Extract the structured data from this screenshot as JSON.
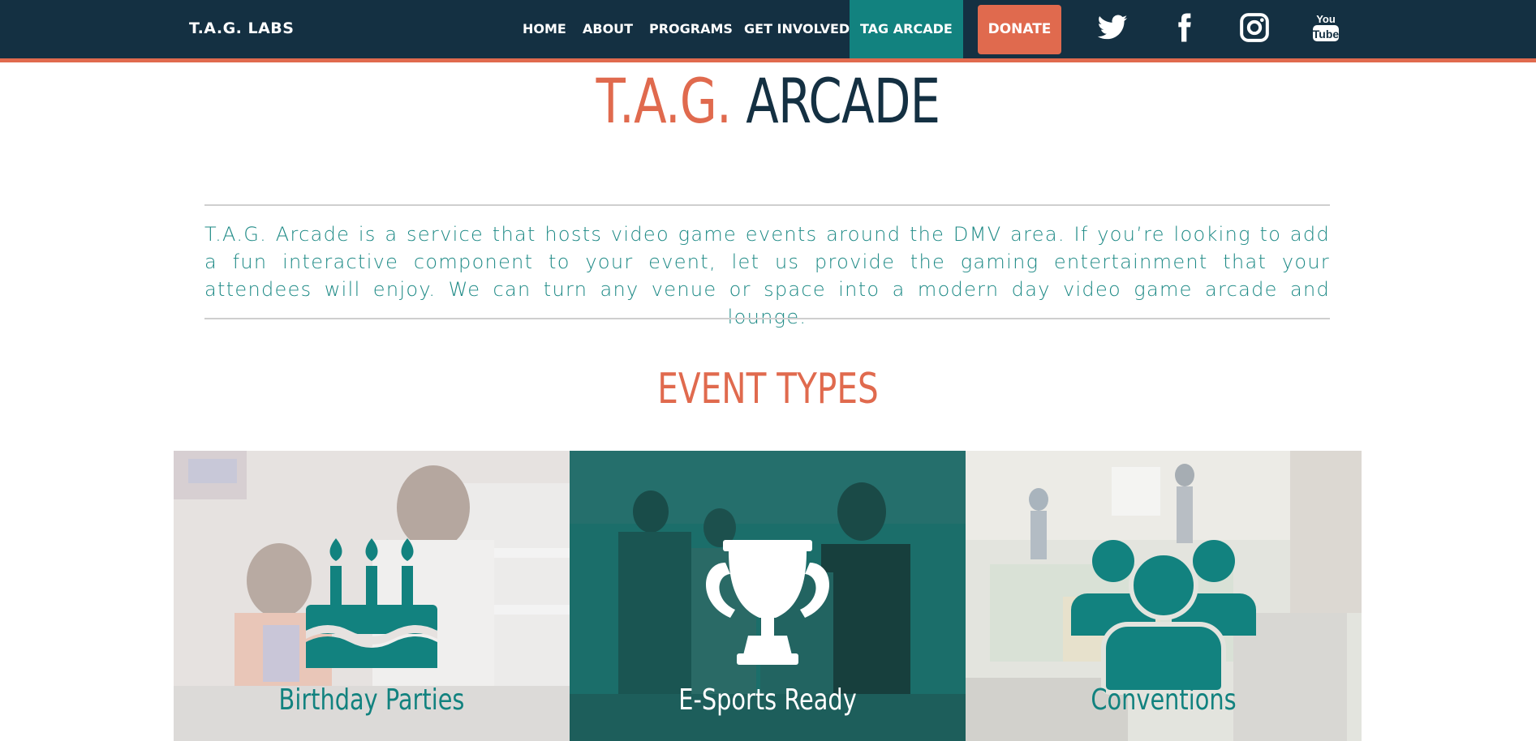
{
  "header": {
    "brand": "T.A.G. LABS",
    "nav": [
      {
        "label": "HOME"
      },
      {
        "label": "ABOUT"
      },
      {
        "label": "PROGRAMS"
      },
      {
        "label": "GET INVOLVED"
      },
      {
        "label": "TAG ARCADE",
        "active": true
      }
    ],
    "donate_label": "DONATE",
    "social": [
      "twitter-icon",
      "facebook-icon",
      "instagram-icon",
      "youtube-icon"
    ],
    "youtube_text_top": "You",
    "youtube_text_bottom": "Tube"
  },
  "page": {
    "title_accent": "T.A.G.",
    "title_main": "ARCADE",
    "intro": "T.A.G. Arcade is a service that hosts video game events around the DMV area. If you’re looking to add a fun interactive component to your event, let us provide the gaming entertainment that your attendees will enjoy. We can turn any venue or space into a modern day video game arcade and lounge.",
    "section_title": "EVENT TYPES"
  },
  "event_types": [
    {
      "label": "Birthday Parties",
      "icon": "birthday-cake-icon"
    },
    {
      "label": "E-Sports Ready",
      "icon": "trophy-icon"
    },
    {
      "label": "Conventions",
      "icon": "group-icon"
    }
  ],
  "colors": {
    "navy": "#143042",
    "orange": "#e06a4e",
    "teal": "#12827f"
  }
}
